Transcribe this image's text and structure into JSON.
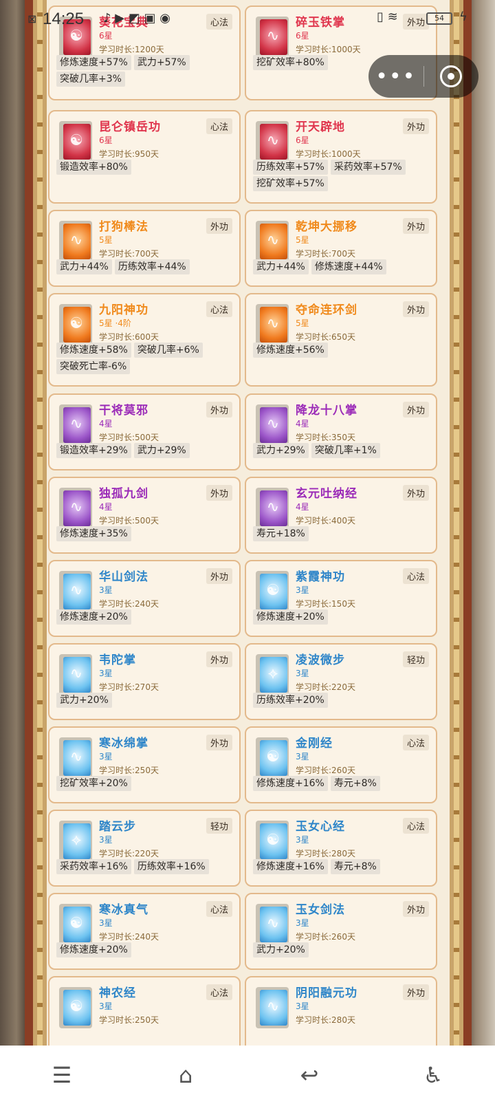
{
  "status_bar": {
    "time": "14:25",
    "battery": "54"
  },
  "capsule": {
    "more": "•••"
  },
  "cards": [
    {
      "name": "葵花宝典",
      "stars": "6星",
      "duration": "学习时长:1200天",
      "type": "心法",
      "tags": [
        "修炼速度+57%",
        "武力+57%",
        "突破几率+3%"
      ],
      "color": "red"
    },
    {
      "name": "碎玉铁掌",
      "stars": "6星",
      "duration": "学习时长:1000天",
      "type": "外功",
      "tags": [
        "挖矿效率+80%"
      ],
      "color": "red"
    },
    {
      "name": "昆仑镇岳功",
      "stars": "6星",
      "duration": "学习时长:950天",
      "type": "心法",
      "tags": [
        "锻造效率+80%"
      ],
      "color": "red"
    },
    {
      "name": "开天辟地",
      "stars": "6星",
      "duration": "学习时长:1000天",
      "type": "外功",
      "tags": [
        "历练效率+57%",
        "采药效率+57%",
        "挖矿效率+57%"
      ],
      "color": "red"
    },
    {
      "name": "打狗棒法",
      "stars": "5星",
      "duration": "学习时长:700天",
      "type": "外功",
      "tags": [
        "武力+44%",
        "历练效率+44%"
      ],
      "color": "orange"
    },
    {
      "name": "乾坤大挪移",
      "stars": "5星",
      "duration": "学习时长:700天",
      "type": "外功",
      "tags": [
        "武力+44%",
        "修炼速度+44%"
      ],
      "color": "orange"
    },
    {
      "name": "九阳神功",
      "stars": "5星 ·4阶",
      "duration": "学习时长:600天",
      "type": "心法",
      "tags": [
        "修炼速度+58%",
        "突破几率+6%",
        "突破死亡率-6%"
      ],
      "color": "orange"
    },
    {
      "name": "夺命连环剑",
      "stars": "5星",
      "duration": "学习时长:650天",
      "type": "外功",
      "tags": [
        "修炼速度+56%"
      ],
      "color": "orange"
    },
    {
      "name": "干将莫邪",
      "stars": "4星",
      "duration": "学习时长:500天",
      "type": "外功",
      "tags": [
        "锻造效率+29%",
        "武力+29%"
      ],
      "color": "purple"
    },
    {
      "name": "降龙十八掌",
      "stars": "4星",
      "duration": "学习时长:350天",
      "type": "外功",
      "tags": [
        "武力+29%",
        "突破几率+1%"
      ],
      "color": "purple"
    },
    {
      "name": "独孤九剑",
      "stars": "4星",
      "duration": "学习时长:500天",
      "type": "外功",
      "tags": [
        "修炼速度+35%"
      ],
      "color": "purple"
    },
    {
      "name": "玄元吐纳经",
      "stars": "4星",
      "duration": "学习时长:400天",
      "type": "外功",
      "tags": [
        "寿元+18%"
      ],
      "color": "purple"
    },
    {
      "name": "华山剑法",
      "stars": "3星",
      "duration": "学习时长:240天",
      "type": "外功",
      "tags": [
        "修炼速度+20%"
      ],
      "color": "blue"
    },
    {
      "name": "紫霞神功",
      "stars": "3星",
      "duration": "学习时长:150天",
      "type": "心法",
      "tags": [
        "修炼速度+20%"
      ],
      "color": "blue"
    },
    {
      "name": "韦陀掌",
      "stars": "3星",
      "duration": "学习时长:270天",
      "type": "外功",
      "tags": [
        "武力+20%"
      ],
      "color": "blue"
    },
    {
      "name": "凌波微步",
      "stars": "3星",
      "duration": "学习时长:220天",
      "type": "轻功",
      "tags": [
        "历练效率+20%"
      ],
      "color": "blue"
    },
    {
      "name": "寒冰绵掌",
      "stars": "3星",
      "duration": "学习时长:250天",
      "type": "外功",
      "tags": [
        "挖矿效率+20%"
      ],
      "color": "blue"
    },
    {
      "name": "金刚经",
      "stars": "3星",
      "duration": "学习时长:260天",
      "type": "心法",
      "tags": [
        "修炼速度+16%",
        "寿元+8%"
      ],
      "color": "blue"
    },
    {
      "name": "踏云步",
      "stars": "3星",
      "duration": "学习时长:220天",
      "type": "轻功",
      "tags": [
        "采药效率+16%",
        "历练效率+16%"
      ],
      "color": "blue"
    },
    {
      "name": "玉女心经",
      "stars": "3星",
      "duration": "学习时长:280天",
      "type": "心法",
      "tags": [
        "修炼速度+16%",
        "寿元+8%"
      ],
      "color": "blue"
    },
    {
      "name": "寒冰真气",
      "stars": "3星",
      "duration": "学习时长:240天",
      "type": "心法",
      "tags": [
        "修炼速度+20%"
      ],
      "color": "blue"
    },
    {
      "name": "玉女剑法",
      "stars": "3星",
      "duration": "学习时长:260天",
      "type": "外功",
      "tags": [
        "武力+20%"
      ],
      "color": "blue"
    },
    {
      "name": "神农经",
      "stars": "3星",
      "duration": "学习时长:250天",
      "type": "心法",
      "tags": [],
      "color": "blue"
    },
    {
      "name": "阴阳融元功",
      "stars": "3星",
      "duration": "学习时长:280天",
      "type": "外功",
      "tags": [],
      "color": "blue"
    }
  ]
}
